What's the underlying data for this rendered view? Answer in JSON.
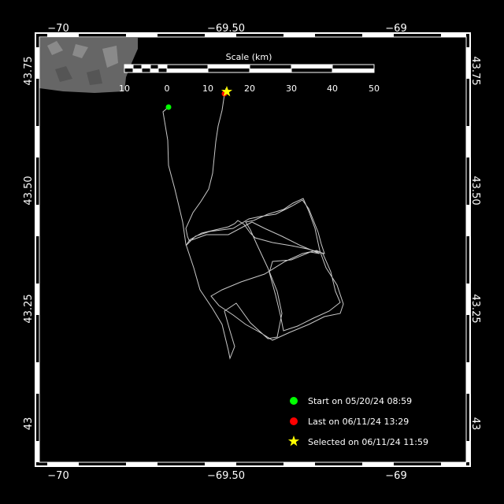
{
  "map": {
    "x_ticks": [
      "−70",
      "−69.50",
      "−69"
    ],
    "y_ticks": [
      "43.75",
      "43.50",
      "43.25",
      "43"
    ],
    "scale": {
      "title": "Scale (km)",
      "ticks": [
        "10",
        "0",
        "10",
        "20",
        "30",
        "40",
        "50"
      ]
    },
    "legend": {
      "start": "Start on 05/20/24 08:59",
      "last": "Last on 06/11/24 13:29",
      "selected": "Selected on 06/11/24 11:59"
    },
    "colors": {
      "start": "#00ff00",
      "last": "#ff0000",
      "selected": "#ffff00",
      "track": "#c8c8c8",
      "land": "#666666"
    }
  }
}
